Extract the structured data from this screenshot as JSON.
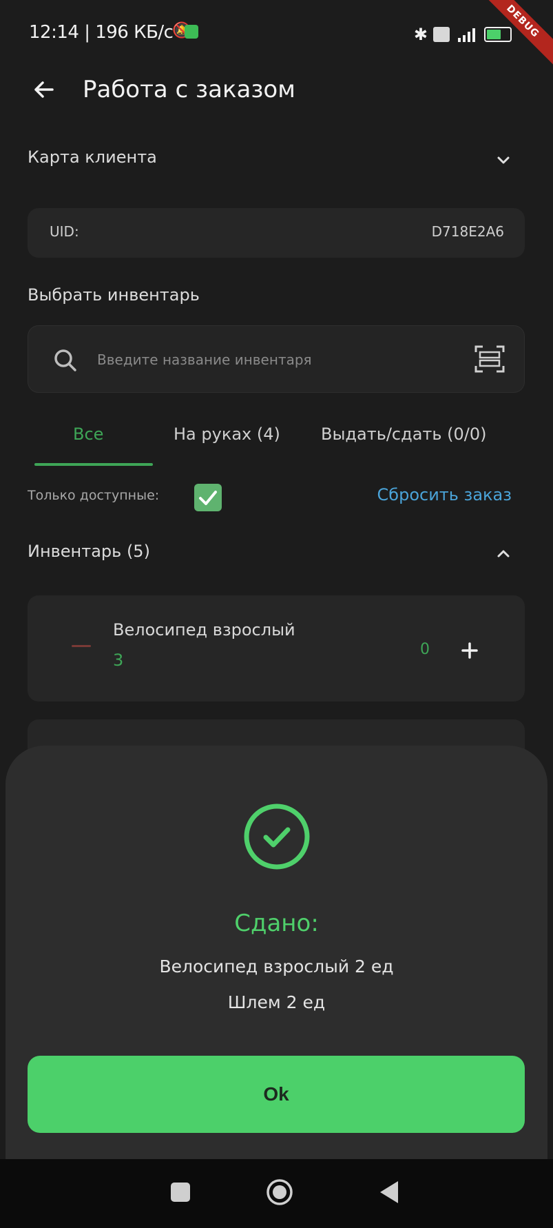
{
  "status_bar": {
    "time": "12:14 | 196 КБ/с",
    "debug_banner": "DEBUG",
    "battery": "51"
  },
  "app_bar": {
    "title": "Работа с заказом"
  },
  "client_card": {
    "label": "Карта клиента",
    "uid_label": "UID:",
    "uid_value": "D718E2A6"
  },
  "inventory_select": {
    "label": "Выбрать инвентарь",
    "search_placeholder": "Введите название инвентаря"
  },
  "tabs": [
    {
      "label": "Все",
      "active": true
    },
    {
      "label": "На руках (4)",
      "active": false
    },
    {
      "label": "Выдать/сдать (0/0)",
      "active": false
    }
  ],
  "filters": {
    "only_available_label": "Только доступные:",
    "only_available_checked": true,
    "reset_order_label": "Сбросить заказ"
  },
  "inventory": {
    "header": "Инвентарь (5)",
    "items": [
      {
        "name": "Велосипед взрослый",
        "available": "3",
        "count": "0"
      }
    ]
  },
  "result_sheet": {
    "title": "Сдано:",
    "lines": [
      "Велосипед взрослый 2 ед",
      "Шлем 2 ед"
    ],
    "ok_label": "Ok"
  },
  "colors": {
    "accent_green": "#4cd06a",
    "link_blue": "#4aa3d8",
    "background": "#1c1c1c"
  }
}
